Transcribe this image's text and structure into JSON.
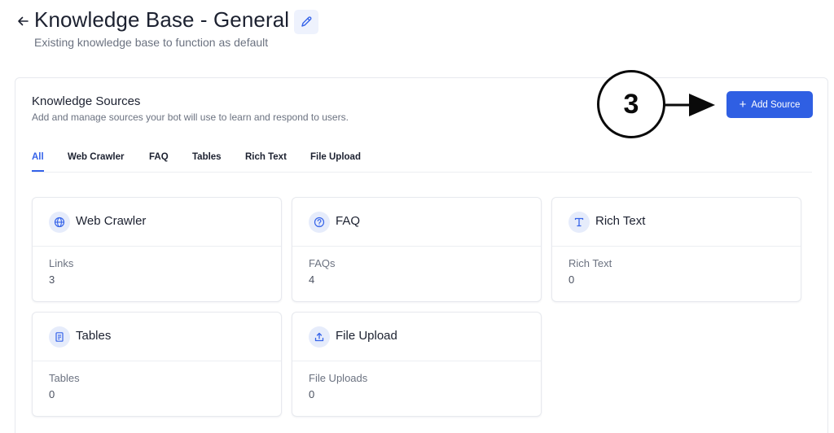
{
  "header": {
    "title": "Knowledge Base - General",
    "subtitle": "Existing knowledge base to function as default"
  },
  "panel": {
    "title": "Knowledge Sources",
    "subtitle": "Add and manage sources your bot will use to learn and respond to users.",
    "add_button": "Add Source",
    "callout_number": "3"
  },
  "tabs": [
    {
      "label": "All",
      "active": true
    },
    {
      "label": "Web Crawler"
    },
    {
      "label": "FAQ"
    },
    {
      "label": "Tables"
    },
    {
      "label": "Rich Text"
    },
    {
      "label": "File Upload"
    }
  ],
  "cards": [
    {
      "title": "Web Crawler",
      "label": "Links",
      "value": "3",
      "icon": "globe-icon"
    },
    {
      "title": "FAQ",
      "label": "FAQs",
      "value": "4",
      "icon": "question-circle-icon"
    },
    {
      "title": "Rich Text",
      "label": "Rich Text",
      "value": "0",
      "icon": "text-t-icon"
    },
    {
      "title": "Tables",
      "label": "Tables",
      "value": "0",
      "icon": "document-icon"
    },
    {
      "title": "File Upload",
      "label": "File Uploads",
      "value": "0",
      "icon": "upload-icon"
    }
  ],
  "colors": {
    "accent": "#3563e9",
    "button": "#2f5fe3",
    "icon_bg": "#e6ecfb"
  }
}
